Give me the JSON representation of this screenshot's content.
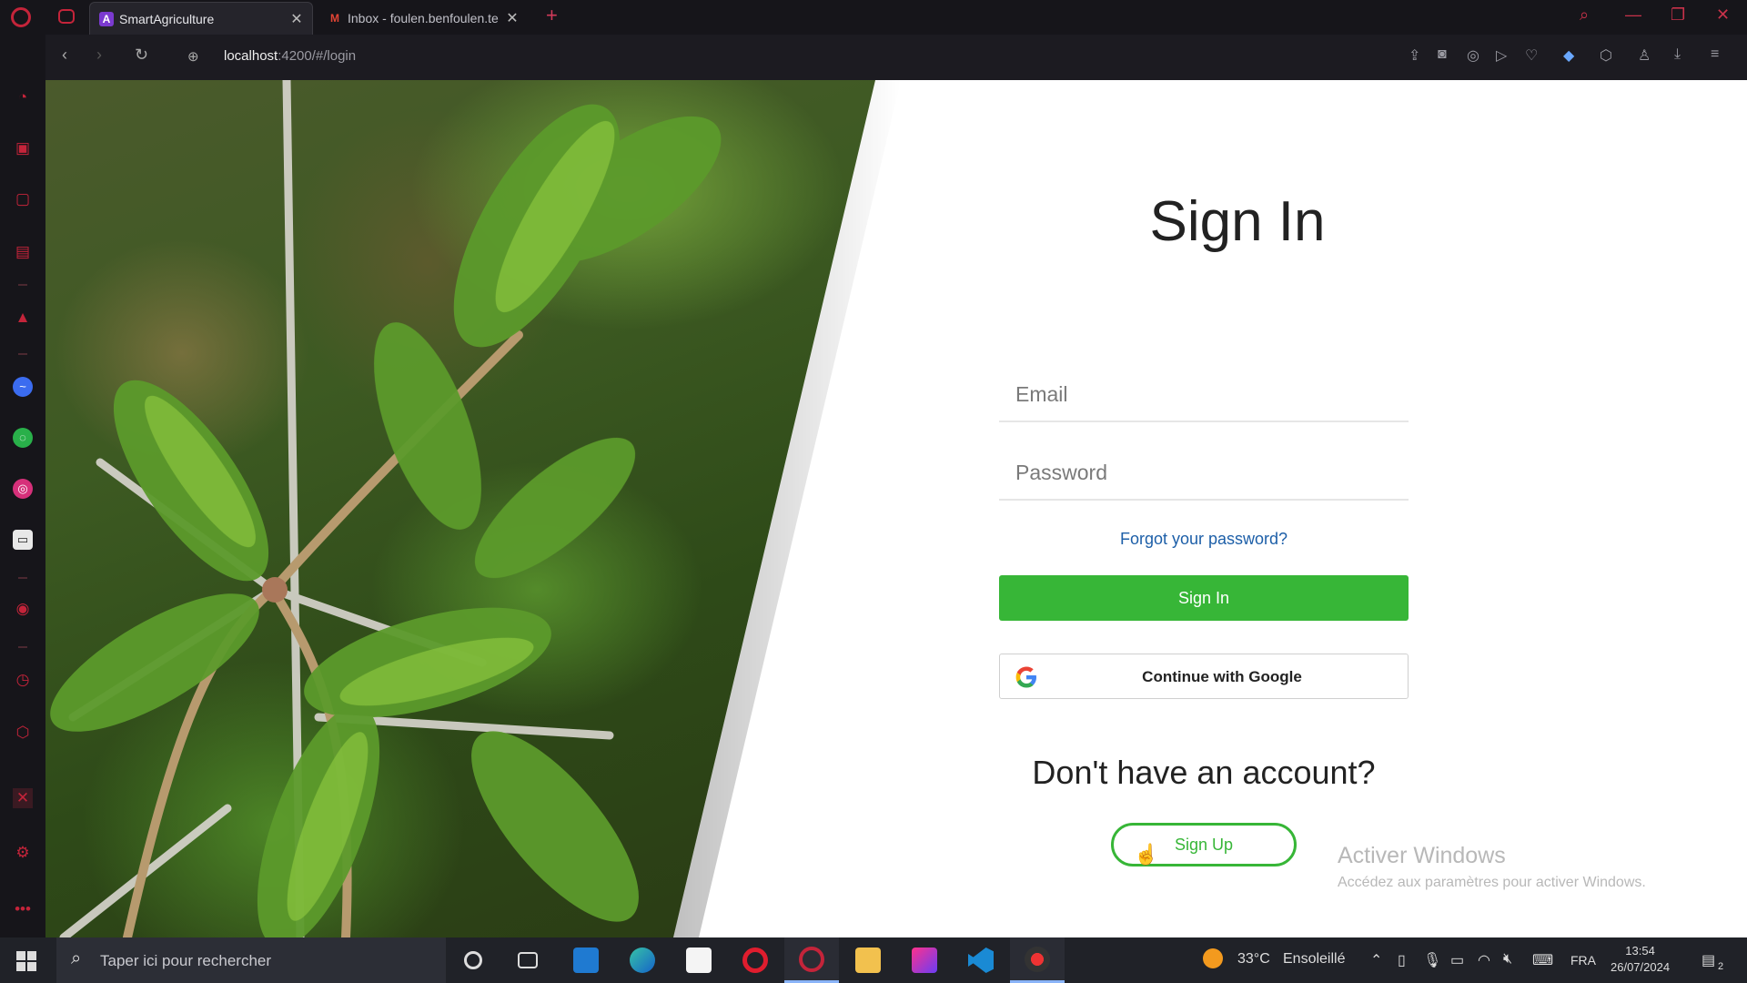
{
  "browser": {
    "tabs": [
      {
        "title": "SmartAgriculture",
        "favicon": "angular-icon",
        "active": true
      },
      {
        "title": "Inbox - foulen.benfoulen.te",
        "favicon": "gmail-icon",
        "active": false
      }
    ],
    "url_host": "localhost",
    "url_rest": ":4200/#/login"
  },
  "login": {
    "title": "Sign In",
    "email_placeholder": "Email",
    "password_placeholder": "Password",
    "forgot_password": "Forgot your password?",
    "sign_in_button": "Sign In",
    "google_button": "Continue with Google",
    "no_account_text": "Don't have an account?",
    "sign_up_button": "Sign Up"
  },
  "watermark": {
    "line1": "Activer Windows",
    "line2": "Accédez aux paramètres pour activer Windows."
  },
  "taskbar": {
    "search_placeholder": "Taper ici pour rechercher",
    "weather_temp": "33°C",
    "weather_text": "Ensoleillé",
    "language": "FRA",
    "time": "13:54",
    "date": "26/07/2024",
    "notification_count": "2"
  },
  "colors": {
    "primary_green": "#37b637",
    "link_blue": "#1d5fa8",
    "opera_red": "#c4243a"
  }
}
